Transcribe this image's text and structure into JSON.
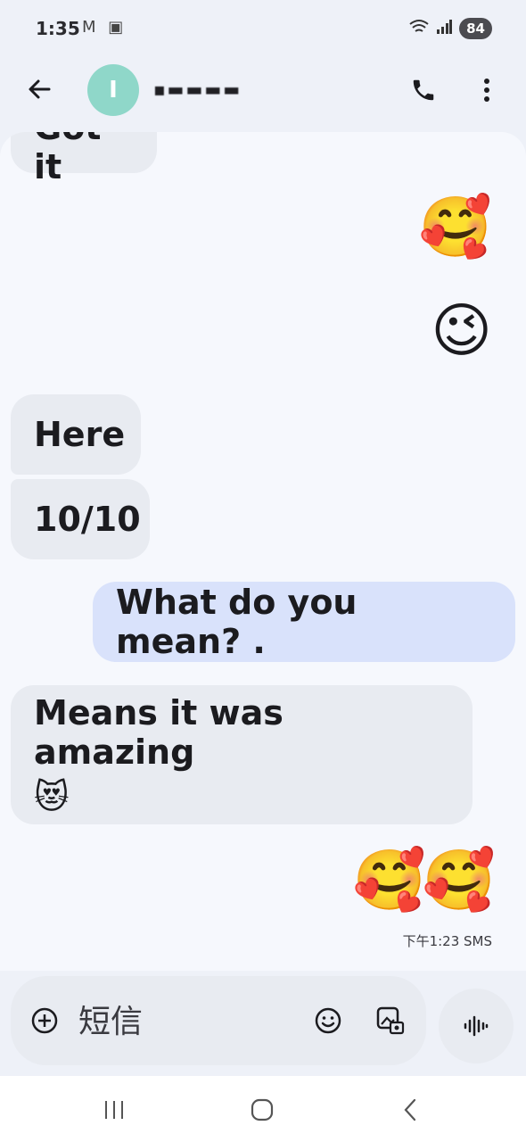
{
  "status_bar": {
    "time": "1:35",
    "left_icons": [
      "gmail-icon",
      "screenshot-icon"
    ],
    "battery": "84"
  },
  "header": {
    "avatar_letter": "I",
    "contact_name": "▪▬▬▬▬",
    "back_icon": "arrow-back-icon",
    "call_icon": "phone-icon",
    "more_icon": "more-vert-icon"
  },
  "messages": [
    {
      "direction": "in",
      "text": "Got it"
    },
    {
      "direction": "out",
      "text": "🥰"
    },
    {
      "direction": "out",
      "text": "😉"
    },
    {
      "direction": "in",
      "text": "Here"
    },
    {
      "direction": "in",
      "text": "10/10"
    },
    {
      "direction": "out",
      "text": "What do you mean? ."
    },
    {
      "direction": "in",
      "text": "Means it was amazing",
      "emoji": "😻"
    },
    {
      "direction": "out",
      "text": "🥰🥰"
    }
  ],
  "timestamp": "下午1:23 SMS",
  "composer": {
    "placeholder": "短信",
    "icons": [
      "add-icon",
      "emoji-icon",
      "gallery-icon",
      "voice-icon"
    ]
  },
  "navbar": {
    "icons": [
      "recents-icon",
      "home-icon",
      "back-icon"
    ]
  },
  "colors": {
    "background": "#eef1f8",
    "incoming_bubble": "#e8ebf1",
    "outgoing_bubble": "#d9e2fb",
    "avatar": "#8fd7c9"
  }
}
